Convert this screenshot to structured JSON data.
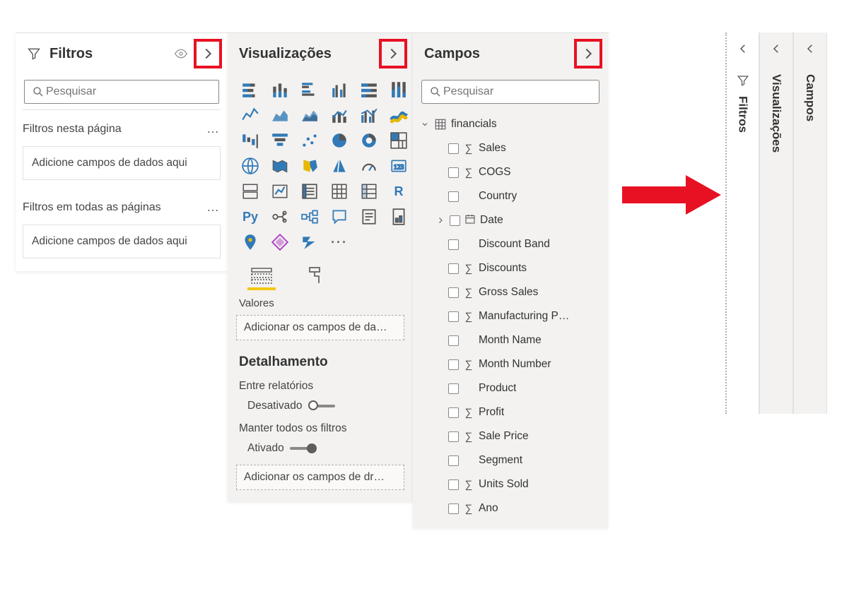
{
  "filters": {
    "title": "Filtros",
    "search_placeholder": "Pesquisar",
    "section_page": "Filtros nesta página",
    "section_all": "Filtros em todas as páginas",
    "drop_hint": "Adicione campos de dados aqui"
  },
  "viz": {
    "title": "Visualizações",
    "values_label": "Valores",
    "values_hint": "Adicionar os campos de da…",
    "drill_title": "Detalhamento",
    "cross_report_label": "Entre relatórios",
    "cross_report_state": "Desativado",
    "keep_filters_label": "Manter todos os filtros",
    "keep_filters_state": "Ativado",
    "drill_hint": "Adicionar os campos de dr…",
    "icons": [
      "stacked-bar",
      "stacked-column",
      "clustered-bar",
      "clustered-column",
      "100-stacked-bar",
      "100-stacked-column",
      "line",
      "area",
      "stacked-area",
      "line-column",
      "line-clustered",
      "ribbon",
      "waterfall",
      "funnel",
      "scatter",
      "pie",
      "donut",
      "treemap",
      "map",
      "filled-map",
      "shape-map",
      "azure-map",
      "gauge",
      "card",
      "multi-row-card",
      "kpi",
      "slicer",
      "table",
      "matrix",
      "r-visual",
      "py-visual",
      "key-influencers",
      "decomposition",
      "qna",
      "narrative",
      "paginated",
      "arcgis",
      "powerapps",
      "powerautomate",
      "more"
    ]
  },
  "fields": {
    "title": "Campos",
    "search_placeholder": "Pesquisar",
    "table": "financials",
    "items": [
      {
        "name": " Sales",
        "sigma": true
      },
      {
        "name": "COGS",
        "sigma": true
      },
      {
        "name": "Country",
        "sigma": false
      },
      {
        "name": "Date",
        "sigma": false,
        "expandable": true,
        "icon": "calendar"
      },
      {
        "name": "Discount Band",
        "sigma": false
      },
      {
        "name": "Discounts",
        "sigma": true
      },
      {
        "name": "Gross Sales",
        "sigma": true
      },
      {
        "name": "Manufacturing P…",
        "sigma": true
      },
      {
        "name": "Month Name",
        "sigma": false
      },
      {
        "name": "Month Number",
        "sigma": true
      },
      {
        "name": "Product",
        "sigma": false
      },
      {
        "name": "Profit",
        "sigma": true
      },
      {
        "name": "Sale Price",
        "sigma": true
      },
      {
        "name": "Segment",
        "sigma": false
      },
      {
        "name": "Units Sold",
        "sigma": true
      },
      {
        "name": "Ano",
        "sigma": true
      }
    ]
  },
  "collapsed": {
    "filters": "Filtros",
    "viz": "Visualizações",
    "fields": "Campos"
  }
}
